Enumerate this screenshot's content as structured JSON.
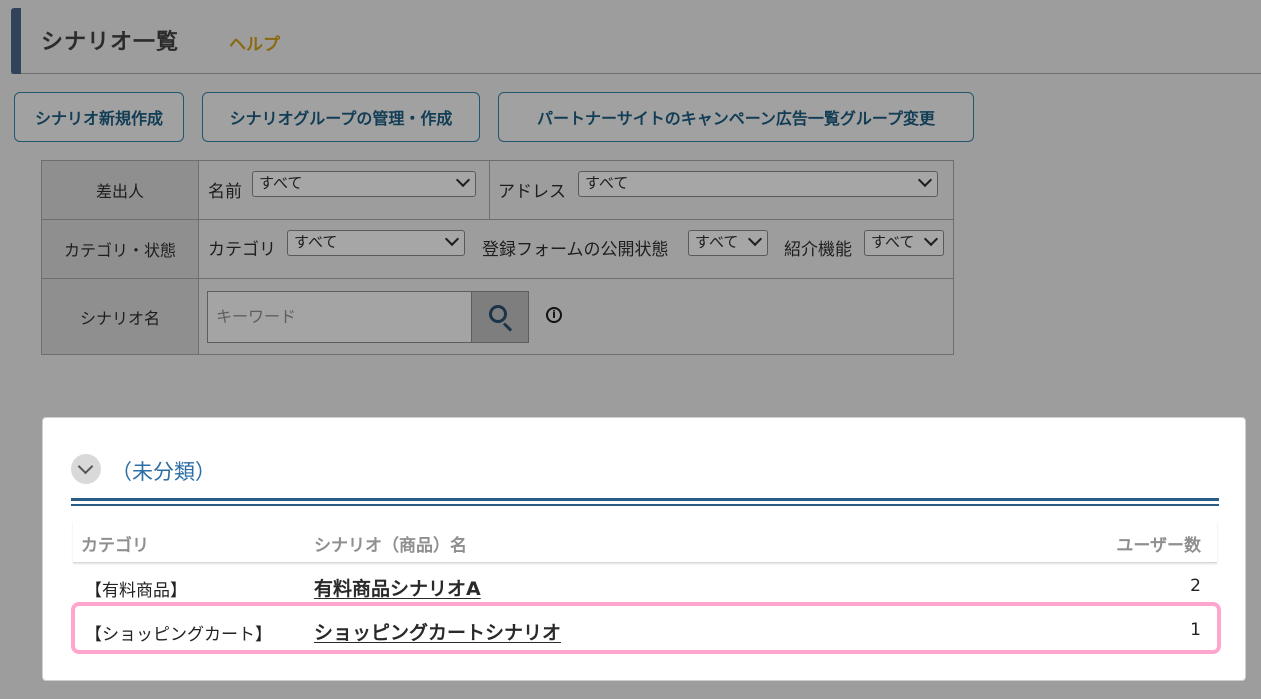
{
  "header": {
    "title": "シナリオ一覧",
    "help_link": "ヘルプ"
  },
  "actions": {
    "new_scenario": "シナリオ新規作成",
    "manage_groups": "シナリオグループの管理・作成",
    "change_partner_group": "パートナーサイトのキャンペーン広告一覧グループ変更"
  },
  "filters": {
    "sender_label": "差出人",
    "name_label": "名前",
    "name_value": "すべて",
    "address_label": "アドレス",
    "address_value": "すべて",
    "category_status_label": "カテゴリ・状態",
    "category_label": "カテゴリ",
    "category_value": "すべて",
    "form_public_label": "登録フォームの公開状態",
    "form_public_value": "すべて",
    "intro_label": "紹介機能",
    "intro_value": "すべて",
    "scenario_name_label": "シナリオ名",
    "keyword_placeholder": "キーワード"
  },
  "panel": {
    "group_title": "（未分類）",
    "columns": {
      "category": "カテゴリ",
      "scenario_name": "シナリオ（商品）名",
      "users": "ユーザー数"
    },
    "rows": [
      {
        "category": "【有料商品】",
        "name": "有料商品シナリオA",
        "users": "2"
      },
      {
        "category": "【ショッピングカート】",
        "name": "ショッピングカートシナリオ",
        "users": "1"
      }
    ]
  },
  "colors": {
    "accent": "#2c6ea6",
    "highlight": "#ffa6cf",
    "header_bar": "#31435a"
  }
}
